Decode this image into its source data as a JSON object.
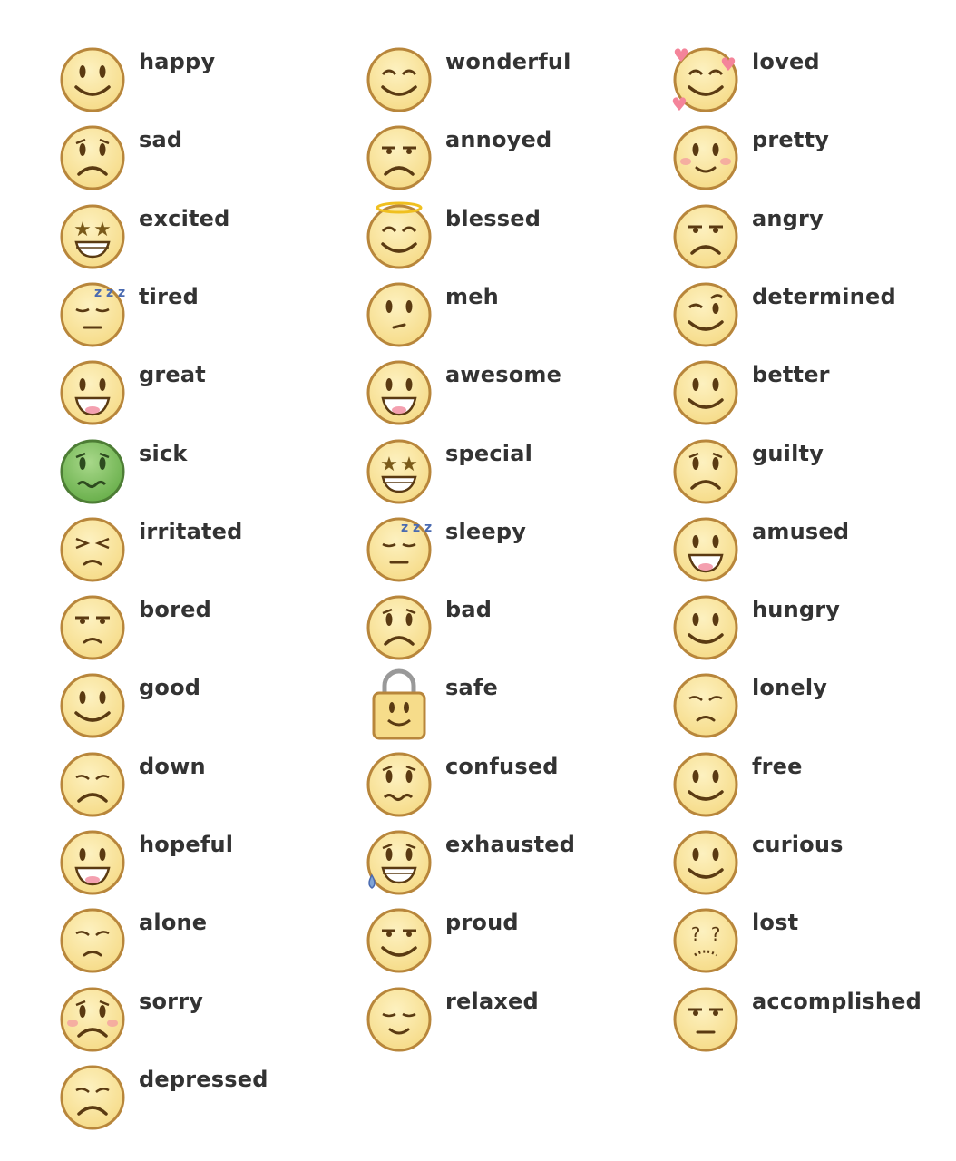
{
  "columns": [
    {
      "items": [
        {
          "label": "happy",
          "icon": "smile-icon",
          "mouth": "smile"
        },
        {
          "label": "sad",
          "icon": "sad-icon",
          "mouth": "frown",
          "brows": "worried"
        },
        {
          "label": "excited",
          "icon": "star-eyes-grin-icon",
          "mouth": "teeth",
          "eyes": "star"
        },
        {
          "label": "tired",
          "icon": "sleepy-zzz-icon",
          "mouth": "flat",
          "eyes": "closed",
          "extra": "zzz"
        },
        {
          "label": "great",
          "icon": "big-grin-icon",
          "mouth": "open"
        },
        {
          "label": "sick",
          "icon": "sick-green-icon",
          "mouth": "wavy",
          "brows": "worried",
          "color": "green"
        },
        {
          "label": "irritated",
          "icon": "squint-icon",
          "mouth": "smallfrown",
          "eyes": "squint"
        },
        {
          "label": "bored",
          "icon": "bored-icon",
          "mouth": "smallfrown",
          "eyes": "lids"
        },
        {
          "label": "good",
          "icon": "smile-icon",
          "mouth": "smile"
        },
        {
          "label": "down",
          "icon": "down-icon",
          "mouth": "frown",
          "eyes": "closedsad"
        },
        {
          "label": "hopeful",
          "icon": "big-grin-icon",
          "mouth": "open"
        },
        {
          "label": "alone",
          "icon": "alone-icon",
          "mouth": "smallfrown",
          "eyes": "closedsad"
        },
        {
          "label": "sorry",
          "icon": "sorry-blush-icon",
          "mouth": "frown",
          "brows": "worried",
          "extra": "blush"
        },
        {
          "label": "depressed",
          "icon": "depressed-icon",
          "mouth": "frown",
          "eyes": "closedsad"
        }
      ]
    },
    {
      "items": [
        {
          "label": "wonderful",
          "icon": "content-smile-icon",
          "mouth": "smile",
          "eyes": "happyclosed"
        },
        {
          "label": "annoyed",
          "icon": "annoyed-icon",
          "mouth": "frown",
          "eyes": "lids"
        },
        {
          "label": "blessed",
          "icon": "halo-icon",
          "mouth": "smile",
          "eyes": "happyclosed",
          "extra": "halo"
        },
        {
          "label": "meh",
          "icon": "meh-icon",
          "mouth": "smirk"
        },
        {
          "label": "awesome",
          "icon": "big-grin-icon",
          "mouth": "open"
        },
        {
          "label": "special",
          "icon": "star-eyes-grin-icon",
          "mouth": "teeth",
          "eyes": "star"
        },
        {
          "label": "sleepy",
          "icon": "sleepy-zzz-icon",
          "mouth": "flat",
          "eyes": "closed",
          "extra": "zzz"
        },
        {
          "label": "bad",
          "icon": "sad-icon",
          "mouth": "frown",
          "brows": "worried"
        },
        {
          "label": "safe",
          "icon": "lock-icon",
          "mouth": "smile",
          "extra": "lock"
        },
        {
          "label": "confused",
          "icon": "confused-icon",
          "mouth": "wavy",
          "brows": "worried"
        },
        {
          "label": "exhausted",
          "icon": "sweat-drop-icon",
          "mouth": "teeth",
          "brows": "worried",
          "extra": "drop"
        },
        {
          "label": "proud",
          "icon": "proud-icon",
          "mouth": "smile",
          "eyes": "lids"
        },
        {
          "label": "relaxed",
          "icon": "relaxed-icon",
          "mouth": "smallsmile",
          "eyes": "closed"
        }
      ]
    },
    {
      "items": [
        {
          "label": "loved",
          "icon": "hearts-icon",
          "mouth": "smile",
          "eyes": "happyclosed",
          "extra": "hearts"
        },
        {
          "label": "pretty",
          "icon": "blush-smile-icon",
          "mouth": "smallsmile",
          "extra": "blush"
        },
        {
          "label": "angry",
          "icon": "angry-icon",
          "mouth": "frown",
          "eyes": "lids"
        },
        {
          "label": "determined",
          "icon": "determined-icon",
          "mouth": "smile",
          "eyes": "wink"
        },
        {
          "label": "better",
          "icon": "smile-icon",
          "mouth": "smile"
        },
        {
          "label": "guilty",
          "icon": "sad-icon",
          "mouth": "frown",
          "brows": "worried"
        },
        {
          "label": "amused",
          "icon": "big-grin-icon",
          "mouth": "open"
        },
        {
          "label": "hungry",
          "icon": "smile-icon",
          "mouth": "smile"
        },
        {
          "label": "lonely",
          "icon": "alone-icon",
          "mouth": "smallfrown",
          "eyes": "closedsad"
        },
        {
          "label": "free",
          "icon": "smile-icon",
          "mouth": "smile"
        },
        {
          "label": "curious",
          "icon": "smile-icon",
          "mouth": "smile"
        },
        {
          "label": "lost",
          "icon": "question-eyes-icon",
          "mouth": "dots",
          "eyes": "question"
        },
        {
          "label": "accomplished",
          "icon": "smirk-icon",
          "mouth": "flat",
          "eyes": "lids"
        }
      ]
    }
  ],
  "colors": {
    "text": "#333333",
    "face": "#f6dc8a",
    "face_light": "#fdf1c0",
    "outline": "#b8863b",
    "feature": "#5a3a12",
    "sick": "#6ab04c"
  }
}
